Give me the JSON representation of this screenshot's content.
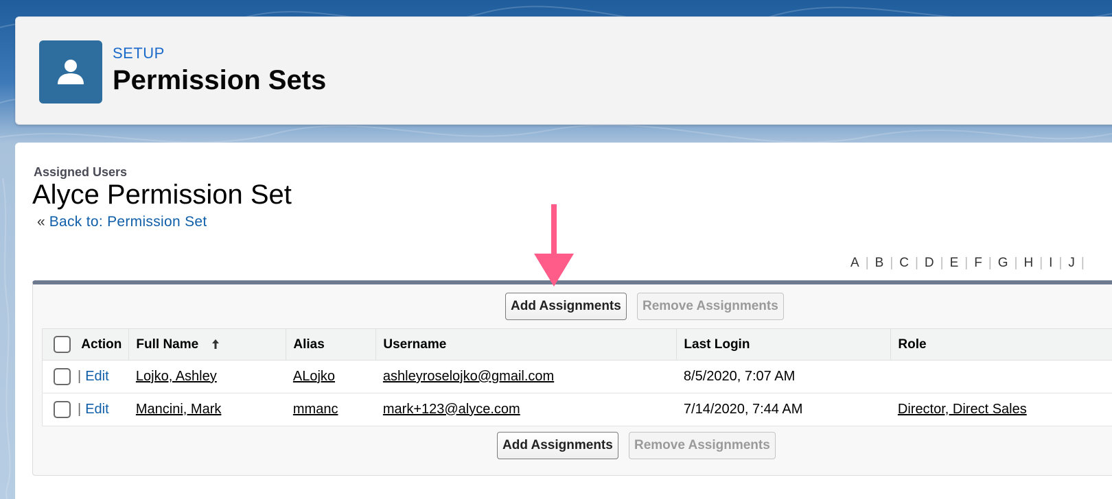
{
  "header": {
    "eyebrow": "SETUP",
    "title": "Permission Sets",
    "icon": "user-icon"
  },
  "page": {
    "section_label": "Assigned Users",
    "title": "Alyce Permission Set",
    "back_prefix": "«",
    "back_link": "Back to: Permission Set"
  },
  "alpha_filter": [
    "A",
    "B",
    "C",
    "D",
    "E",
    "F",
    "G",
    "H",
    "I",
    "J"
  ],
  "buttons": {
    "add": "Add Assignments",
    "remove": "Remove Assignments"
  },
  "table": {
    "columns": [
      "Action",
      "Full Name",
      "Alias",
      "Username",
      "Last Login",
      "Role"
    ],
    "sort_icon": "arrow-up-icon",
    "edit_label": "Edit",
    "action_separator": "|",
    "rows": [
      {
        "full_name": "Lojko, Ashley",
        "alias": "ALojko",
        "username": "ashleyroselojko@gmail.com",
        "last_login": "8/5/2020, 7:07 AM",
        "role": ""
      },
      {
        "full_name": "Mancini, Mark",
        "alias": "mmanc",
        "username": "mark+123@alyce.com",
        "last_login": "7/14/2020, 7:44 AM",
        "role": "Director, Direct Sales"
      }
    ]
  },
  "colors": {
    "accent": "#ff5c8a",
    "link": "#0f5ea8",
    "icon_bg": "#2e6e9e"
  }
}
